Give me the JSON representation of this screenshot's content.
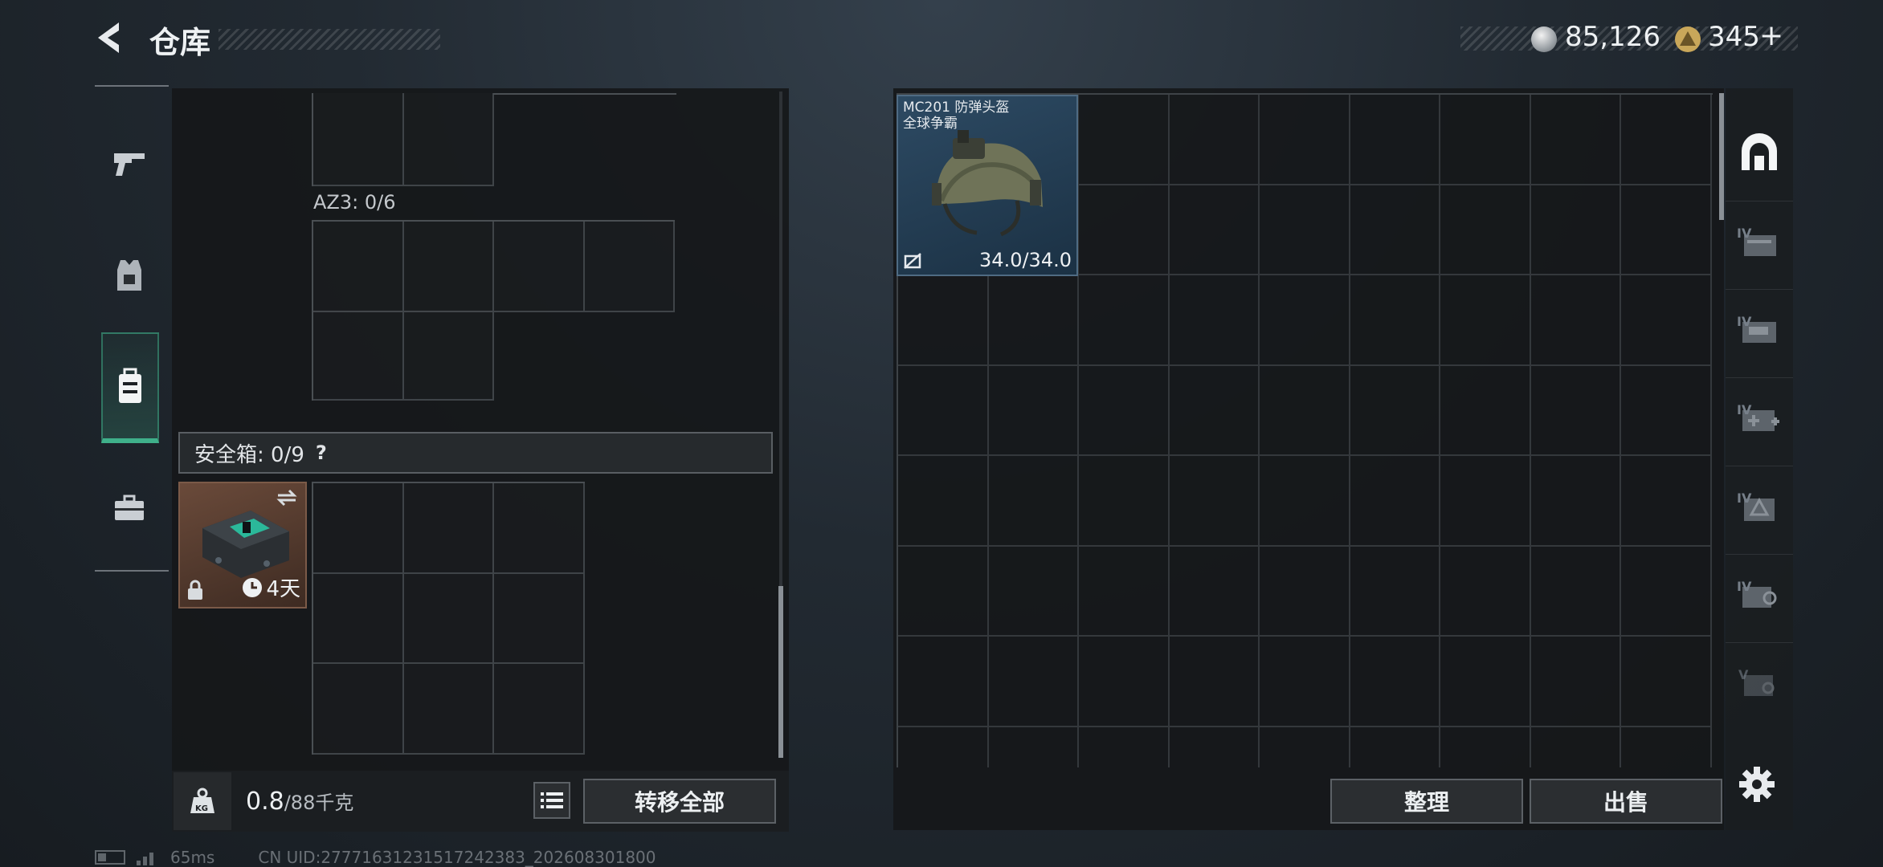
{
  "header": {
    "title": "仓库",
    "currency1": "85,126",
    "currency2": "345",
    "currency2_add": "+"
  },
  "containers": {
    "az3_label": "AZ3: 0/6",
    "safebox_label": "安全箱: 0/9",
    "safebox_help": "?",
    "safebox_item_timer": "4天"
  },
  "bottom_left": {
    "weight_current": "0.8",
    "weight_max": "/88千克",
    "weight_icon_text": "KG",
    "transfer_all": "转移全部"
  },
  "stash": {
    "item_name_line1": "MC201 防弹头盔",
    "item_name_line2": "全球争霸",
    "item_durability": "34.0/34.0",
    "sort_button": "整理",
    "sell_button": "出售"
  },
  "right_tabs": {
    "tiers": [
      "IV",
      "IV",
      "IV",
      "IV",
      "IV",
      "V"
    ]
  },
  "status_bar": {
    "ping": "65ms",
    "uid": "CN UID:27771631231517242383_202608301800"
  },
  "colors": {
    "accent_green": "#3fb08a",
    "panel_bg": "#16181a",
    "grid_line": "#3f4448"
  }
}
